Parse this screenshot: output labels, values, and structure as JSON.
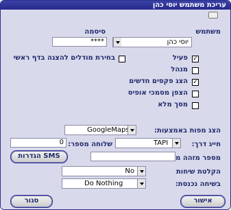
{
  "window": {
    "title": "עריכת משתמש יוסי כהן"
  },
  "form": {
    "username_label": "משתמש",
    "username_value": "יוסי כהן",
    "password_label": "סיסמה",
    "password_value": "****",
    "active_label": "פעיל",
    "active_checked": true,
    "manager_label": "מנהל",
    "manager_checked": false,
    "show_new_faxes_label": "הצג פקסים חדשים",
    "show_new_faxes_checked": true,
    "office_docs_flood_label": "הצפן מסמכי אופיס",
    "office_docs_flood_checked": false,
    "full_screen_label": "מסך מלא",
    "full_screen_checked": false,
    "select_modules_label": "בחירת מודלים להצגה בדף ראשי",
    "select_modules_checked": false,
    "show_maps_label": "הצג מפות באמצעות:",
    "show_maps_value": "GoogleMaps",
    "dialer_label": "חייג דרך:",
    "dialer_value": "TAPI",
    "extension_label": "שלוחה מספר:",
    "extension_value": "0",
    "caller_id_label": "מספר מזהה מחייגים:",
    "caller_id_value": "",
    "sms_settings_button": "הגדרות SMS",
    "record_calls_label": "הקלטת שיחות",
    "record_calls_value": "No",
    "on_logon_label": "בשיחה נכנסת:",
    "on_logon_value": "Do Nothing"
  },
  "footer": {
    "ok_button": "אישור",
    "close_button": "סגור"
  }
}
